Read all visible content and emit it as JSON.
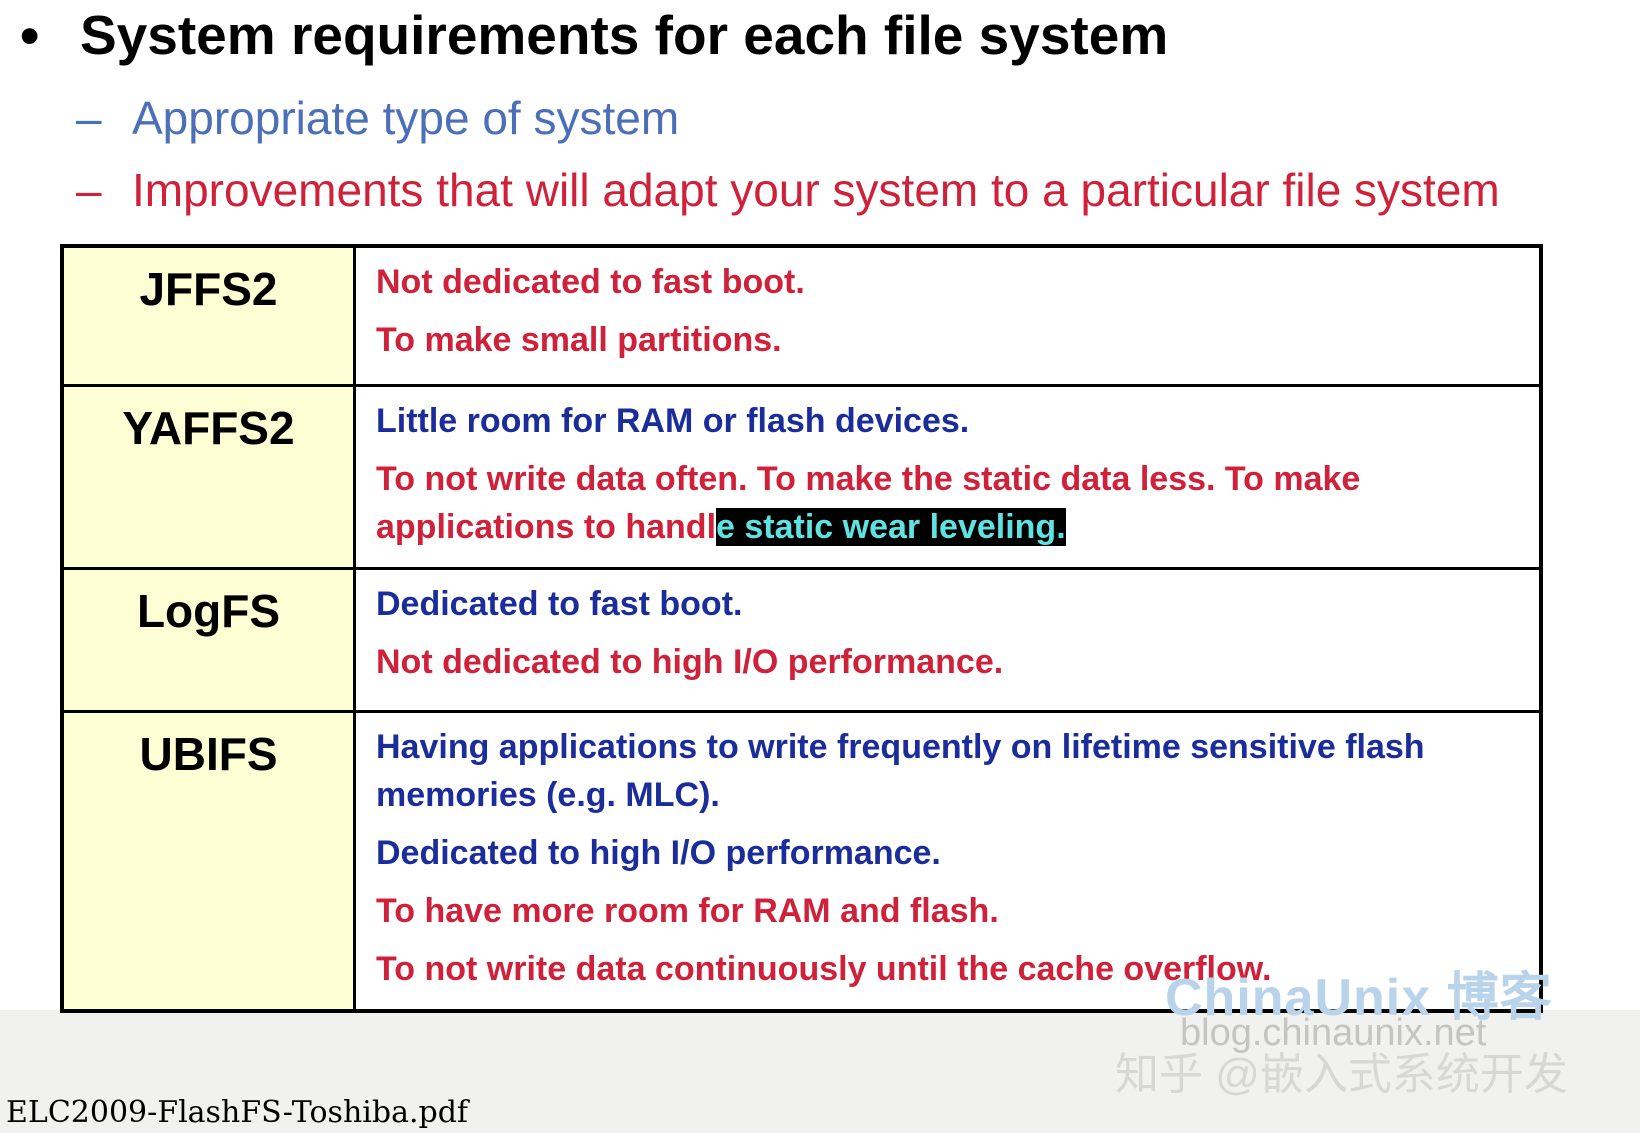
{
  "heading": {
    "bullet": "•",
    "text": "System requirements for each file system"
  },
  "subpoints": [
    {
      "dash": "–",
      "text": "Appropriate type of system",
      "color": "#4b6fb9"
    },
    {
      "dash": "–",
      "text": "Improvements that will adapt your system to a particular file system",
      "color": "#d0213a"
    }
  ],
  "table": {
    "rows": [
      {
        "fs": "JFFS2",
        "lines": [
          {
            "color": "red",
            "text": "Not dedicated to fast boot."
          },
          {
            "color": "red",
            "text": "To make small partitions."
          }
        ]
      },
      {
        "fs": "YAFFS2",
        "lines": [
          {
            "color": "blue",
            "text": "Little room for RAM or flash devices."
          },
          {
            "color": "red",
            "text": "To not write data often.  To make the static data less.  To make applications to handl",
            "highlight": "e static wear leveling",
            "tail": "."
          }
        ]
      },
      {
        "fs": "LogFS",
        "lines": [
          {
            "color": "blue",
            "text": "Dedicated to fast boot."
          },
          {
            "color": "red",
            "text": "Not dedicated to high I/O performance."
          }
        ]
      },
      {
        "fs": "UBIFS",
        "lines": [
          {
            "color": "blue",
            "text": "Having applications to write frequently on lifetime sensitive flash memories (e.g. MLC)."
          },
          {
            "color": "blue",
            "text": "Dedicated to high I/O performance."
          },
          {
            "color": "red",
            "text": "To have more room for RAM and flash."
          },
          {
            "color": "red",
            "text": "To not write data continuously until the cache overflow."
          }
        ]
      }
    ]
  },
  "watermarks": {
    "brand": "ChinaUnix 博客",
    "blog": "blog.chinaunix.net",
    "zhihu": "知乎 @嵌入式系统开发"
  },
  "footer": {
    "filename": "ELC2009-FlashFS-Toshiba.pdf"
  },
  "colors": {
    "cell_fill": "#fefed4",
    "red_text": "#d0213a",
    "blue_text": "#1b2d9a",
    "highlight_bg": "#000000",
    "highlight_text": "#5fe2e2"
  }
}
